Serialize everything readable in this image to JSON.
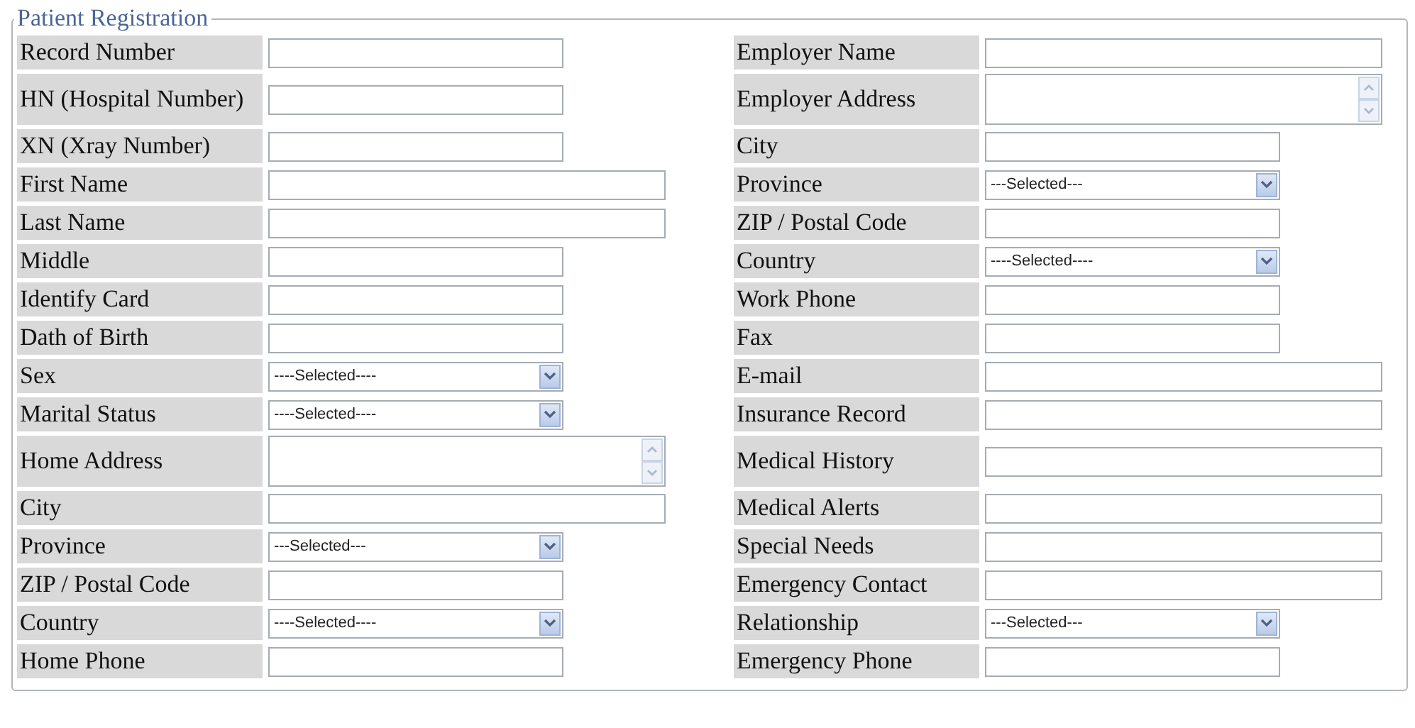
{
  "panel": {
    "title": "Patient Registration"
  },
  "rows": [
    {
      "left": {
        "label": "Record Number",
        "field": {
          "kind": "short-text"
        }
      },
      "right": {
        "label": "Employer Name",
        "field": {
          "kind": "long-text"
        }
      }
    },
    {
      "left": {
        "label": "HN (Hospital Number)",
        "field": {
          "kind": "short-text"
        }
      },
      "right": {
        "label": "Employer Address",
        "field": {
          "kind": "textarea"
        }
      }
    },
    {
      "left": {
        "label": "XN (Xray Number)",
        "field": {
          "kind": "short-text"
        }
      },
      "right": {
        "label": "City",
        "field": {
          "kind": "short-text"
        }
      }
    },
    {
      "left": {
        "label": "First Name",
        "field": {
          "kind": "long-text"
        }
      },
      "right": {
        "label": "Province",
        "field": {
          "kind": "select",
          "value": "---Selected---"
        }
      }
    },
    {
      "left": {
        "label": "Last Name",
        "field": {
          "kind": "long-text"
        }
      },
      "right": {
        "label": "ZIP / Postal Code",
        "field": {
          "kind": "short-text"
        }
      }
    },
    {
      "left": {
        "label": "Middle",
        "field": {
          "kind": "short-text"
        }
      },
      "right": {
        "label": "Country",
        "field": {
          "kind": "select",
          "value": "----Selected----"
        }
      }
    },
    {
      "left": {
        "label": "Identify Card",
        "field": {
          "kind": "short-text"
        }
      },
      "right": {
        "label": "Work Phone",
        "field": {
          "kind": "short-text"
        }
      }
    },
    {
      "left": {
        "label": "Dath of Birth",
        "field": {
          "kind": "short-text"
        }
      },
      "right": {
        "label": "Fax",
        "field": {
          "kind": "short-text"
        }
      }
    },
    {
      "left": {
        "label": "Sex",
        "field": {
          "kind": "select",
          "value": "----Selected----"
        }
      },
      "right": {
        "label": "E-mail",
        "field": {
          "kind": "long-text"
        }
      }
    },
    {
      "left": {
        "label": "Marital Status",
        "field": {
          "kind": "select",
          "value": "----Selected----"
        }
      },
      "right": {
        "label": "Insurance Record",
        "field": {
          "kind": "long-text"
        }
      }
    },
    {
      "left": {
        "label": "Home Address",
        "field": {
          "kind": "textarea"
        }
      },
      "right": {
        "label": "Medical History",
        "field": {
          "kind": "long-text"
        }
      }
    },
    {
      "left": {
        "label": "City",
        "field": {
          "kind": "long-text"
        }
      },
      "right": {
        "label": "Medical Alerts",
        "field": {
          "kind": "long-text"
        }
      }
    },
    {
      "left": {
        "label": "Province",
        "field": {
          "kind": "select",
          "value": "---Selected---"
        }
      },
      "right": {
        "label": "Special Needs",
        "field": {
          "kind": "long-text"
        }
      }
    },
    {
      "left": {
        "label": "ZIP / Postal Code",
        "field": {
          "kind": "short-text"
        }
      },
      "right": {
        "label": "Emergency Contact",
        "field": {
          "kind": "long-text"
        }
      }
    },
    {
      "left": {
        "label": "Country",
        "field": {
          "kind": "select",
          "value": "----Selected----"
        }
      },
      "right": {
        "label": "Relationship",
        "field": {
          "kind": "select",
          "value": "---Selected---"
        }
      }
    },
    {
      "left": {
        "label": "Home Phone",
        "field": {
          "kind": "short-text"
        }
      },
      "right": {
        "label": "Emergency Phone",
        "field": {
          "kind": "short-text"
        }
      }
    }
  ]
}
